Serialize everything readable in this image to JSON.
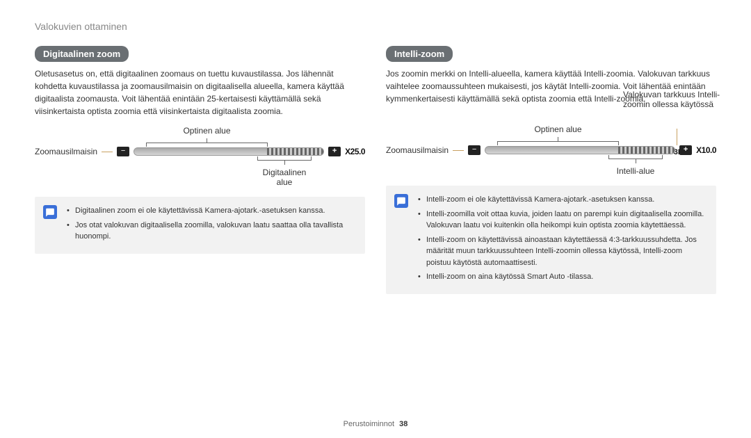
{
  "breadcrumb": "Valokuvien ottaminen",
  "left": {
    "heading": "Digitaalinen zoom",
    "body": "Oletusasetus on, että digitaalinen zoomaus on tuettu kuvaustilassa. Jos lähennät kohdetta kuvaustilassa ja zoomausilmaisin on digitaalisella alueella, kamera käyttää digitaalista zoomausta. Voit lähentää enintään 25-kertaisesti käyttämällä sekä viisinkertaista optista zoomia että viisinkertaista digitaalista zoomia.",
    "diagram": {
      "top_label": "Optinen alue",
      "left_label": "Zoomausilmaisin",
      "value": "X25.0",
      "bottom_label": "Digitaalinen alue",
      "minus": "−",
      "plus": "+"
    },
    "notes": [
      "Digitaalinen zoom ei ole käytettävissä Kamera-ajotark.-asetuksen kanssa.",
      "Jos otat valokuvan digitaalisella zoomilla, valokuvan laatu saattaa olla tavallista huonompi."
    ]
  },
  "right": {
    "heading": "Intelli-zoom",
    "body": "Jos zoomin merkki on Intelli-alueella, kamera käyttää Intelli-zoomia. Valokuvan tarkkuus vaihtelee zoomaussuhteen mukaisesti, jos käytät Intelli-zoomia. Voit lähentää enintään kymmenkertaisesti käyttämällä sekä optista zoomia että Intelli-zoomia.",
    "diagram": {
      "top_label": "Optinen alue",
      "left_label": "Zoomausilmaisin",
      "value": "X10.0",
      "resolution": "3M",
      "right_annot": "Valokuvan tarkkuus Intelli-zoomin ollessa käytössä",
      "bottom_label": "Intelli-alue",
      "minus": "−",
      "plus": "+"
    },
    "notes": [
      "Intelli-zoom ei ole käytettävissä Kamera-ajotark.-asetuksen kanssa.",
      "Intelli-zoomilla voit ottaa kuvia, joiden laatu on parempi kuin digitaalisella zoomilla. Valokuvan laatu voi kuitenkin olla heikompi kuin optista zoomia käytettäessä.",
      "Intelli-zoom on käytettävissä ainoastaan käytettäessä 4:3-tarkkuussuhdetta. Jos määrität muun tarkkuussuhteen Intelli-zoomin ollessa käytössä, Intelli-zoom poistuu käytöstä automaattisesti.",
      "Intelli-zoom on aina käytössä Smart Auto -tilassa."
    ]
  },
  "footer": {
    "section": "Perustoiminnot",
    "page": "38"
  }
}
